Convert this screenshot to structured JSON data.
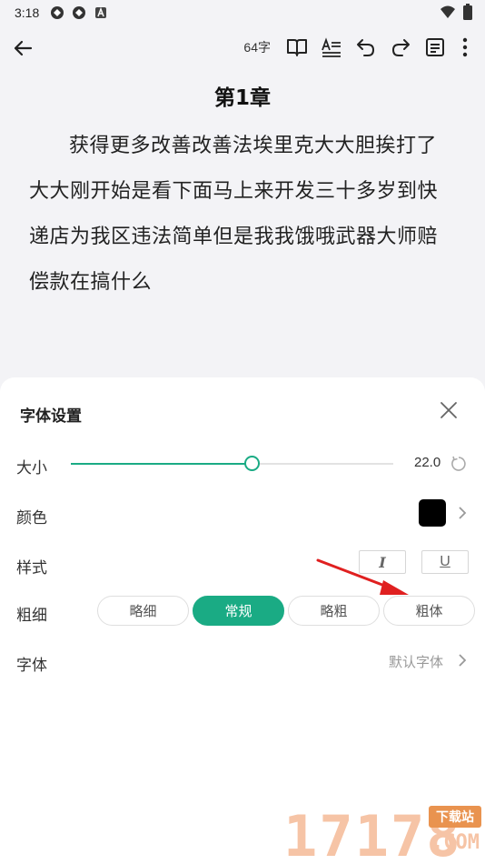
{
  "status_bar": {
    "time": "3:18"
  },
  "toolbar": {
    "word_count": "64字"
  },
  "chapter": {
    "title": "第1章",
    "body": "获得更多改善改善法埃里克大大胆挨打了大大刚开始是看下面马上来开发三十多岁到快递店为我区违法简单但是我我饿哦武器大师赔偿款在搞什么"
  },
  "font_sheet": {
    "title": "字体设置",
    "size": {
      "label": "大小",
      "value": "22.0",
      "fraction": 0.56
    },
    "color": {
      "label": "颜色",
      "swatch": "#000000"
    },
    "style": {
      "label": "样式",
      "italic_glyph": "I",
      "underline_glyph": "U"
    },
    "weight": {
      "label": "粗细",
      "options": [
        "略细",
        "常规",
        "略粗",
        "粗体"
      ],
      "selected": "常规"
    },
    "font": {
      "label": "字体",
      "value": "默认字体"
    }
  },
  "accent_color": "#1aab84",
  "watermark": {
    "number": "17178",
    "badge": "下载站",
    "suffix": ".COM"
  }
}
